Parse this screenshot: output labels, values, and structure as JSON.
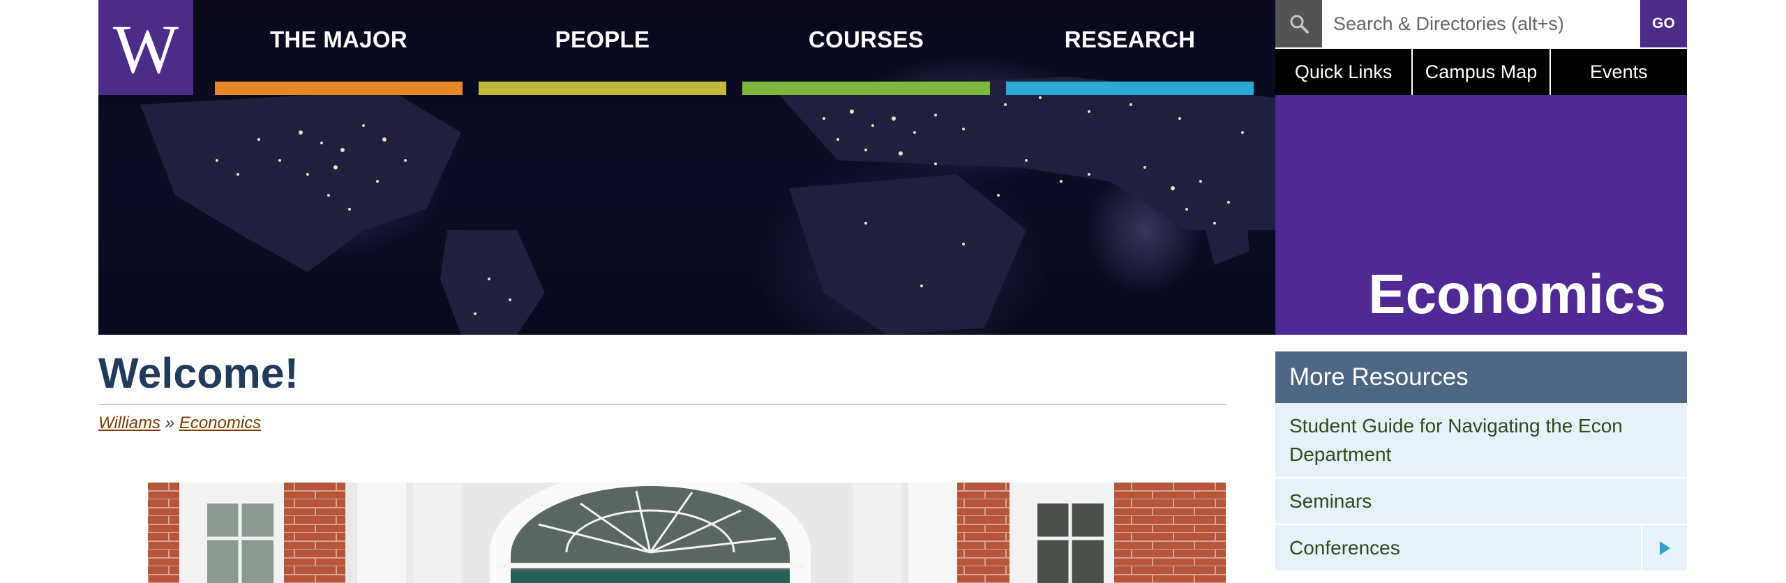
{
  "logo": {
    "letter": "W"
  },
  "nav": [
    {
      "label": "THE MAJOR",
      "color": "#e8862a"
    },
    {
      "label": "PEOPLE",
      "color": "#c2b93a"
    },
    {
      "label": "COURSES",
      "color": "#80b83e"
    },
    {
      "label": "RESEARCH",
      "color": "#2ba8d5"
    }
  ],
  "search": {
    "placeholder": "Search & Directories (alt+s)",
    "go_label": "GO",
    "icon": "search-icon"
  },
  "quick_links": [
    "Quick Links",
    "Campus Map",
    "Events"
  ],
  "department": "Economics",
  "main": {
    "title": "Welcome!",
    "breadcrumb": {
      "root": "Williams",
      "separator": "»",
      "current": "Economics"
    }
  },
  "sidebar": {
    "heading": "More Resources",
    "items": [
      "Student Guide for Navigating the Econ Department",
      "Seminars",
      "Conferences"
    ],
    "expand_icon": "triangle-right-icon"
  },
  "colors": {
    "purple": "#4f2994",
    "header_blue": "#4d6684",
    "title_navy": "#233b5a",
    "sidebar_bg": "#e6f1f9"
  }
}
